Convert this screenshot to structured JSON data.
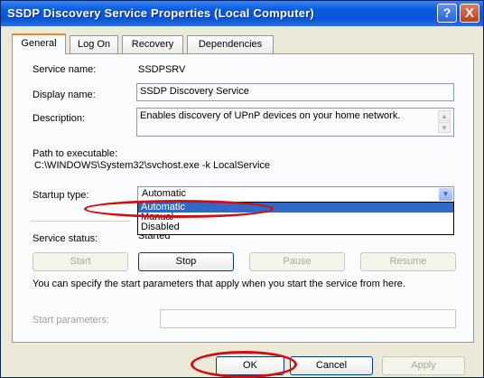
{
  "window": {
    "title": "SSDP Discovery Service Properties (Local Computer)",
    "help_glyph": "?",
    "close_glyph": "X"
  },
  "tabs": [
    {
      "label": "General"
    },
    {
      "label": "Log On"
    },
    {
      "label": "Recovery"
    },
    {
      "label": "Dependencies"
    }
  ],
  "general": {
    "service_name_label": "Service name:",
    "service_name_value": "SSDPSRV",
    "display_name_label": "Display name:",
    "display_name_value": "SSDP Discovery Service",
    "description_label": "Description:",
    "description_value": "Enables discovery of UPnP devices on your home network.",
    "path_label": "Path to executable:",
    "path_value": "C:\\WINDOWS\\System32\\svchost.exe -k LocalService",
    "startup_type_label": "Startup type:",
    "startup_type_value": "Automatic",
    "startup_options": [
      "Automatic",
      "Manual",
      "Disabled"
    ],
    "service_status_label": "Service status:",
    "service_status_value": "Started",
    "start_label": "Start",
    "stop_label": "Stop",
    "pause_label": "Pause",
    "resume_label": "Resume",
    "hint_text": "You can specify the start parameters that apply when you start the service from here.",
    "start_params_label": "Start parameters:"
  },
  "footer": {
    "ok_label": "OK",
    "cancel_label": "Cancel",
    "apply_label": "Apply"
  },
  "colors": {
    "title_bar": "#0656d8",
    "highlight_annotation": "#d01010",
    "selection": "#316ac5"
  }
}
